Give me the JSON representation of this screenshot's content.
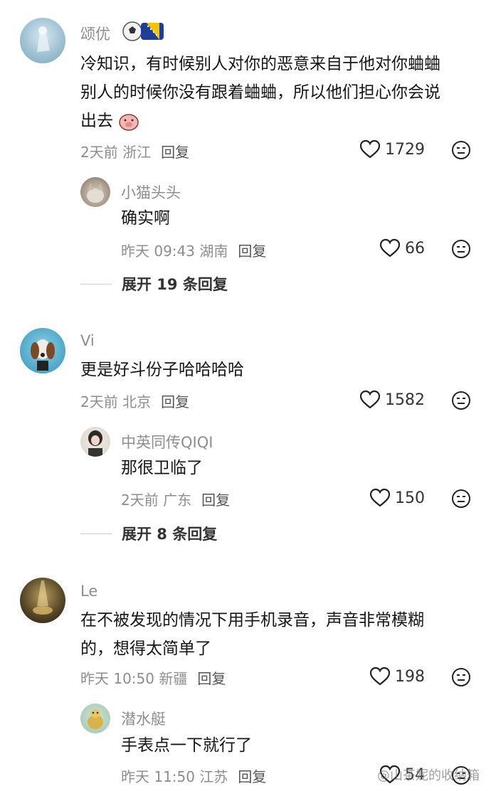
{
  "comments": [
    {
      "username": "颂优",
      "lines": [
        "冷知识，有时候别人对你的恶意来自于他对你蛐蛐",
        "别人的时候你没有跟着蛐蛐，所以他们担心你会说",
        "出去"
      ],
      "time_loc": "2天前 浙江",
      "reply": "回复",
      "likes": "1729",
      "sub": {
        "username": "小猫头头",
        "text": "确实啊",
        "time_loc": "昨天 09:43 湖南",
        "reply": "回复",
        "likes": "66"
      },
      "expand": "展开 19 条回复"
    },
    {
      "username": "Vi",
      "lines": [
        "更是好斗份子哈哈哈哈"
      ],
      "time_loc": "2天前 北京",
      "reply": "回复",
      "likes": "1582",
      "sub": {
        "username": "中英同传QIQI",
        "text": "那很卫临了",
        "time_loc": "2天前 广东",
        "reply": "回复",
        "likes": "150"
      },
      "expand": "展开 8 条回复"
    },
    {
      "username": "Le",
      "lines": [
        "在不被发现的情况下用手机录音，声音非常模糊",
        "的，想得太简单了"
      ],
      "time_loc": "昨天 10:50 新疆",
      "reply": "回复",
      "likes": "198",
      "sub": {
        "username": "潜水艇",
        "text": "手表点一下就行了",
        "time_loc": "昨天 11:50 江苏",
        "reply": "回复",
        "likes": "54"
      }
    }
  ],
  "watermark": "@山茶妮的收纳箱",
  "icons": {
    "like": "heart-outline-icon",
    "dislike": "meh-face-icon",
    "badge": "football-flag-badge"
  },
  "colors": {
    "username": "#8d8d92",
    "text": "#161616",
    "meta": "#8d8d92"
  }
}
